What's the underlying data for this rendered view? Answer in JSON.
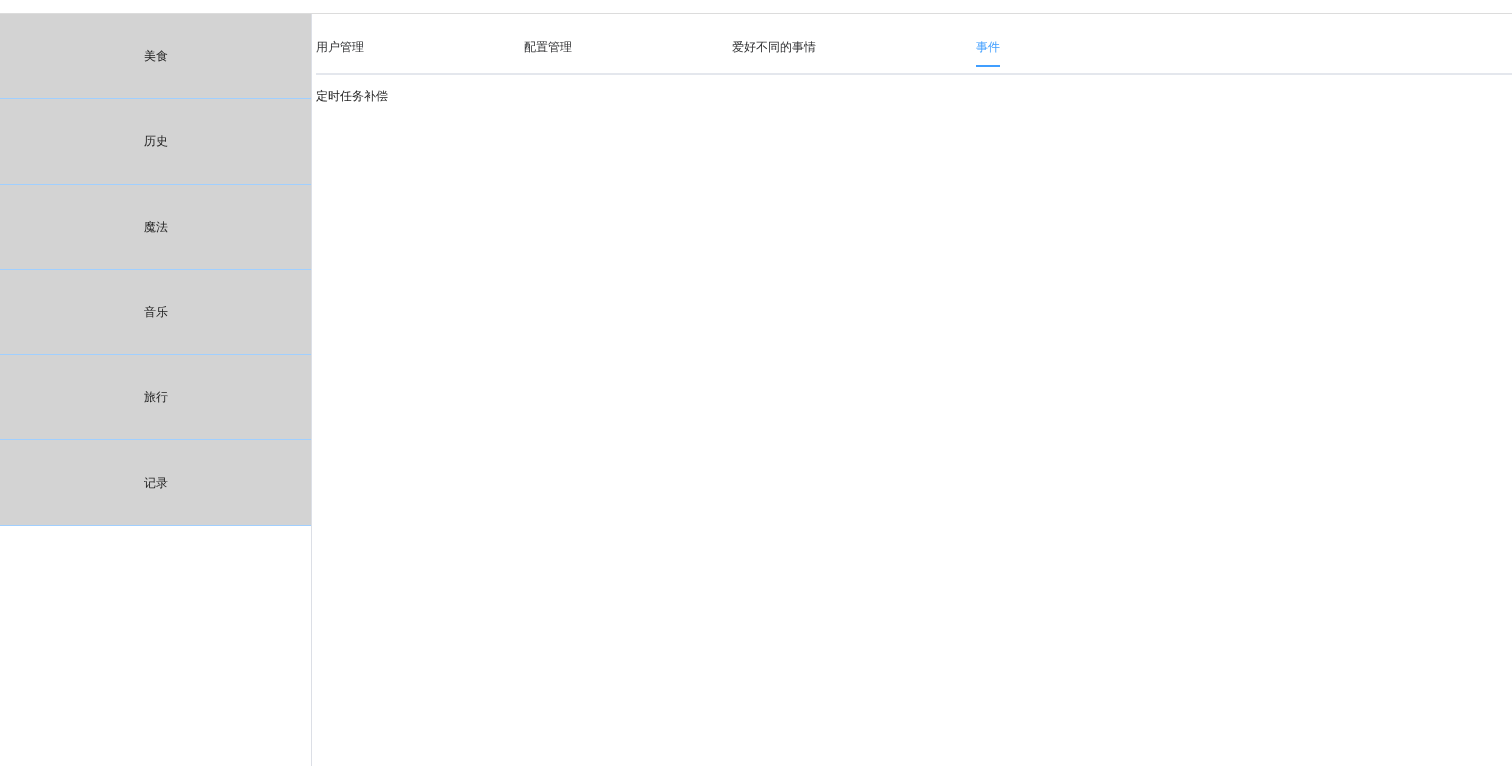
{
  "sidebar": {
    "items": [
      {
        "label": "美食"
      },
      {
        "label": "历史"
      },
      {
        "label": "魔法"
      },
      {
        "label": "音乐"
      },
      {
        "label": "旅行"
      },
      {
        "label": "记录"
      }
    ]
  },
  "tabs": [
    {
      "label": "用户管理",
      "selected": false
    },
    {
      "label": "配置管理",
      "selected": false
    },
    {
      "label": "爱好不同的事情",
      "selected": false
    },
    {
      "label": "事件",
      "selected": true
    }
  ],
  "content": {
    "text": "定时任务补偿"
  }
}
